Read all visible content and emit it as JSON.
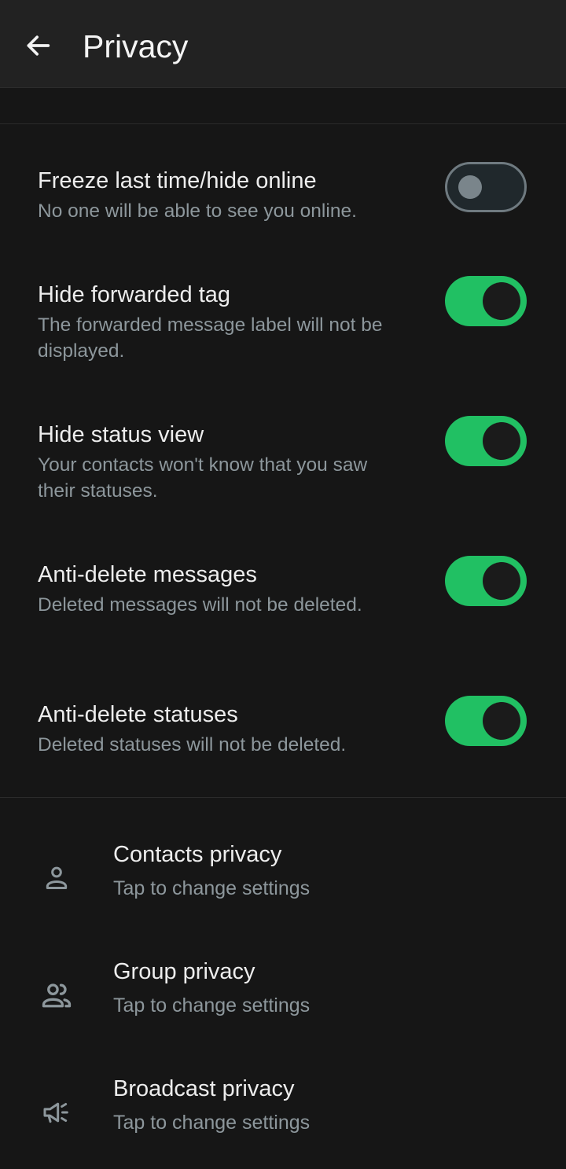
{
  "header": {
    "title": "Privacy",
    "back_icon": "arrow-left-icon"
  },
  "colors": {
    "background": "#161616",
    "appbar": "#222222",
    "accent_green": "#21c063",
    "primary_text": "#ededed",
    "secondary_text": "#8d979c"
  },
  "toggles": [
    {
      "title": "Freeze last time/hide online",
      "description": "No one will be able to see you online.",
      "enabled": false
    },
    {
      "title": "Hide forwarded tag",
      "description": "The forwarded message label will not be displayed.",
      "enabled": true
    },
    {
      "title": "Hide status view",
      "description": "Your contacts won't know that you saw their statuses.",
      "enabled": true
    },
    {
      "title": "Anti-delete messages",
      "description": "Deleted messages will not be deleted.",
      "enabled": true
    },
    {
      "title": "Anti-delete statuses",
      "description": "Deleted statuses will not be deleted.",
      "enabled": true
    }
  ],
  "privacy_items": [
    {
      "title": "Contacts privacy",
      "subtitle": "Tap to change settings",
      "icon": "person-icon"
    },
    {
      "title": "Group privacy",
      "subtitle": "Tap to change settings",
      "icon": "group-icon"
    },
    {
      "title": "Broadcast privacy",
      "subtitle": "Tap to change settings",
      "icon": "megaphone-icon"
    }
  ]
}
